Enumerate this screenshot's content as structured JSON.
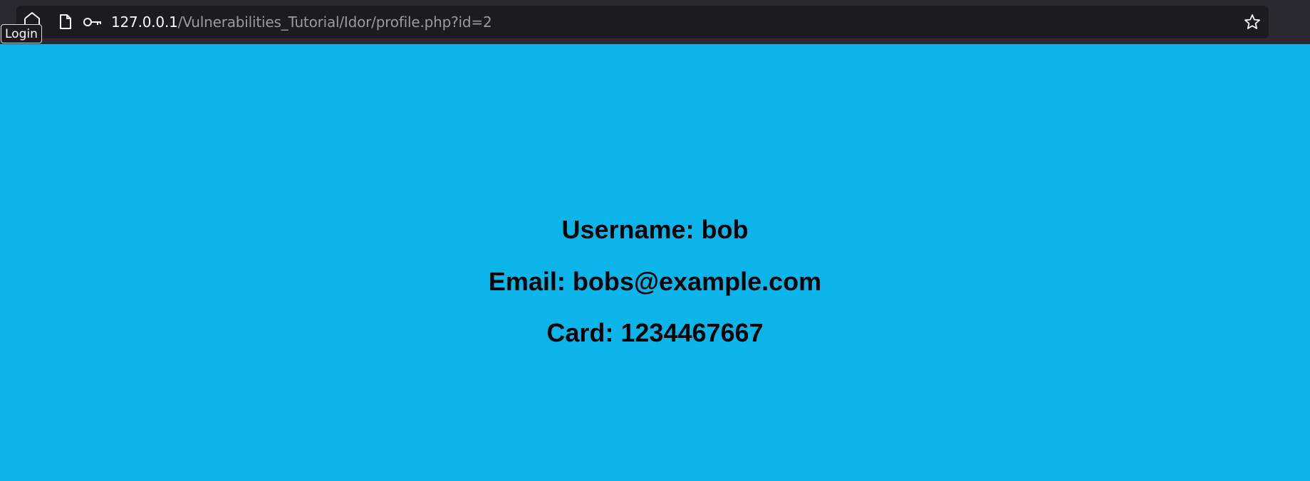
{
  "browser": {
    "url_host": "127.0.0.1",
    "url_path": "/Vulnerabilities_Tutorial/Idor/profile.php?id=2",
    "login_label": "Login",
    "icons": [
      "home-icon",
      "page-icon",
      "key-icon",
      "star-icon"
    ]
  },
  "profile": {
    "username_line": "Username: bob",
    "email_line": "Email: bobs@example.com",
    "card_line": "Card: 1234467667"
  },
  "colors": {
    "page_background": "#0bb4e9",
    "chrome_background": "#2b2a33",
    "urlbar_background": "#1c1b22",
    "text": "#000000"
  }
}
